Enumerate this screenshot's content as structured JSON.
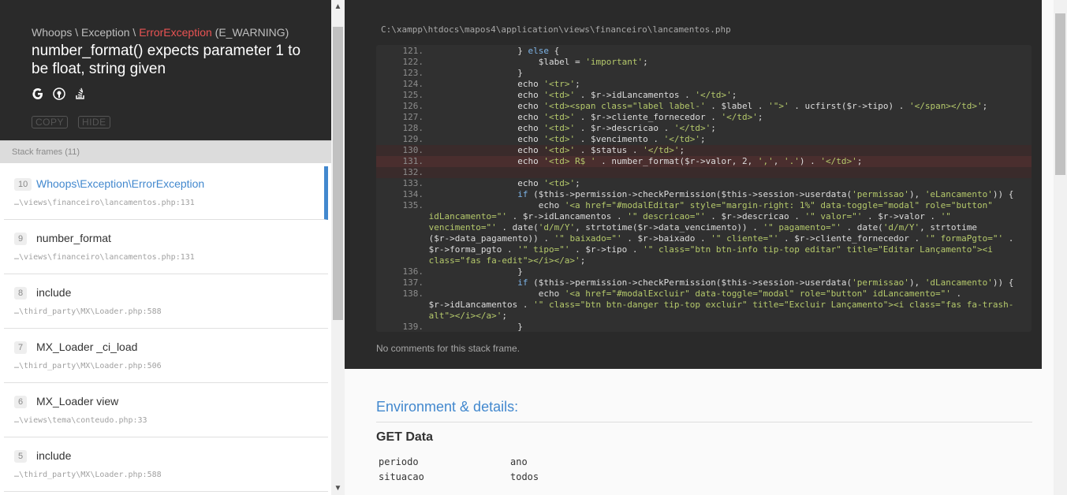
{
  "exception": {
    "path_prefix": "Whoops \\ Exception \\ ",
    "class": "ErrorException",
    "severity": " (E_WARNING)",
    "message": "number_format() expects parameter 1 to be float, string given",
    "copy_label": "COPY",
    "hide_label": "HIDE"
  },
  "frames": {
    "header": "Stack frames (11)",
    "items": [
      {
        "index": "10",
        "name": "Whoops\\Exception\\ErrorException",
        "path": "…\\views\\financeiro\\lancamentos.php:131"
      },
      {
        "index": "9",
        "name": "number_format",
        "path": "…\\views\\financeiro\\lancamentos.php:131"
      },
      {
        "index": "8",
        "name": "include",
        "path": "…\\third_party\\MX\\Loader.php:588"
      },
      {
        "index": "7",
        "name": "MX_Loader _ci_load",
        "path": "…\\third_party\\MX\\Loader.php:506"
      },
      {
        "index": "6",
        "name": "MX_Loader view",
        "path": "…\\views\\tema\\conteudo.php:33"
      },
      {
        "index": "5",
        "name": "include",
        "path": "…\\third_party\\MX\\Loader.php:588"
      }
    ]
  },
  "code": {
    "file": "C:\\xampp\\htdocs\\mapos4\\application\\views\\financeiro\\lancamentos.php",
    "no_comments": "No comments for this stack frame."
  },
  "environment": {
    "title": "Environment & details:",
    "get_title": "GET Data",
    "get": [
      {
        "key": "periodo",
        "value": "ano"
      },
      {
        "key": "situacao",
        "value": "todos"
      }
    ]
  },
  "colors": {
    "accent": "#4288ce",
    "error": "#e95353",
    "dark": "#2a2a2a"
  }
}
